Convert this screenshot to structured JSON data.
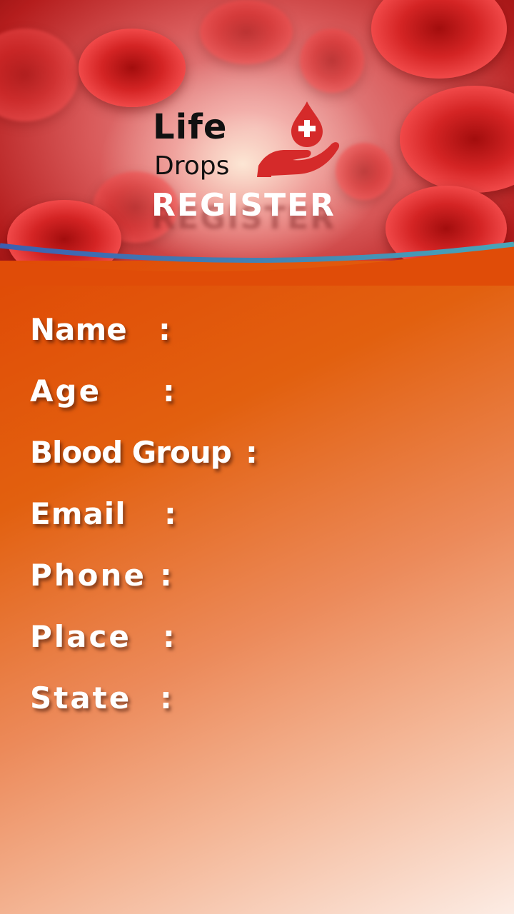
{
  "brand": {
    "name_line1": "Life",
    "name_line2": "Drops",
    "logo_icon": "blood-drop-hand-icon",
    "primary_color": "#e04a06",
    "accent_red": "#d52a2a"
  },
  "screen": {
    "title": "REGISTER"
  },
  "form": {
    "fields": [
      {
        "label": "Name",
        "separator": ":"
      },
      {
        "label": "Age",
        "separator": ":"
      },
      {
        "label": "Blood Group",
        "separator": ":"
      },
      {
        "label": "Email",
        "separator": ":"
      },
      {
        "label": "Phone",
        "separator": ":"
      },
      {
        "label": "Place",
        "separator": ":"
      },
      {
        "label": "State",
        "separator": ":"
      }
    ]
  }
}
